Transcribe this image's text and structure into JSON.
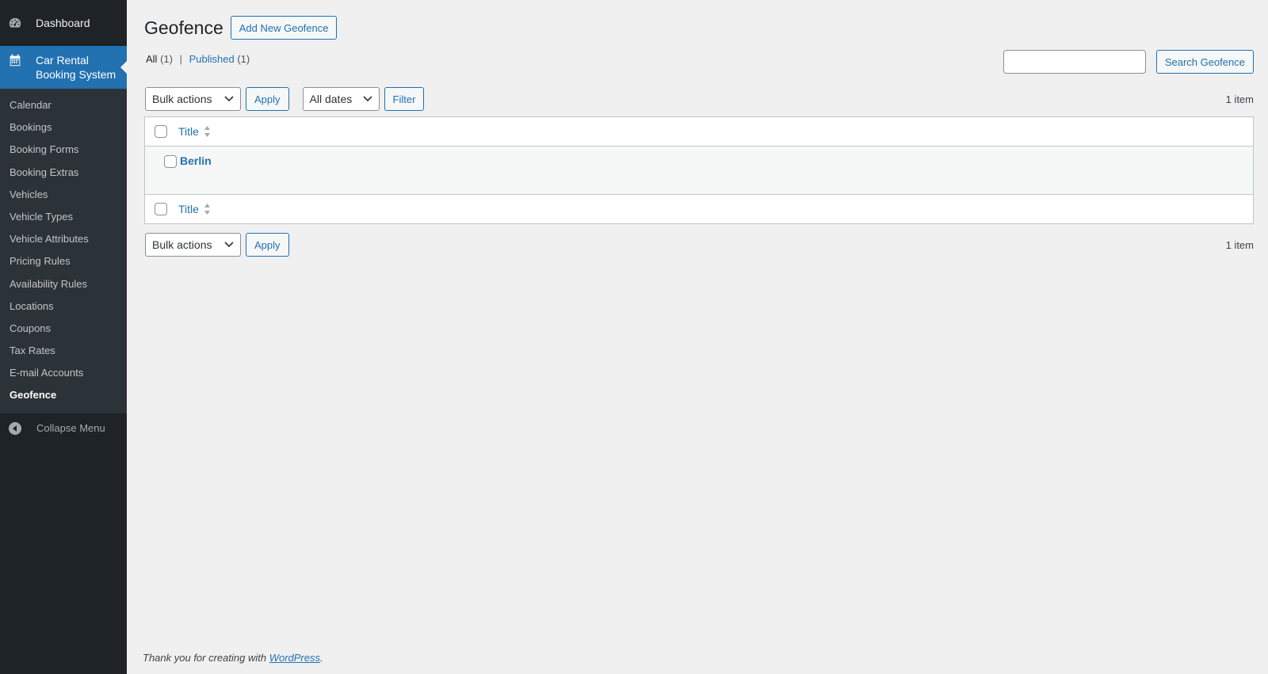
{
  "sidebar": {
    "dashboard_label": "Dashboard",
    "current_menu_label": "Car Rental Booking System",
    "submenu": [
      "Calendar",
      "Bookings",
      "Booking Forms",
      "Booking Extras",
      "Vehicles",
      "Vehicle Types",
      "Vehicle Attributes",
      "Pricing Rules",
      "Availability Rules",
      "Locations",
      "Coupons",
      "Tax Rates",
      "E-mail Accounts",
      "Geofence"
    ],
    "current_submenu": "Geofence",
    "collapse_label": "Collapse Menu"
  },
  "header": {
    "title": "Geofence",
    "add_new_label": "Add New Geofence"
  },
  "views": {
    "all_label": "All",
    "all_count": "(1)",
    "separator": "|",
    "published_label": "Published",
    "published_count": "(1)"
  },
  "search": {
    "value": "",
    "button_label": "Search Geofence"
  },
  "tablenav_top": {
    "bulk_actions": "Bulk actions",
    "apply_label": "Apply",
    "dates_filter": "All dates",
    "filter_label": "Filter",
    "items_count": "1 item"
  },
  "table": {
    "column_title": "Title",
    "rows": [
      {
        "title": "Berlin"
      }
    ]
  },
  "tablenav_bottom": {
    "bulk_actions": "Bulk actions",
    "apply_label": "Apply",
    "items_count": "1 item"
  },
  "footer": {
    "text": "Thank you for creating with",
    "link": "WordPress",
    "suffix": "."
  },
  "colors": {
    "sidebar_bg": "#1d2327",
    "submenu_bg": "#2c3338",
    "accent": "#2271b1",
    "page_bg": "#f0f0f1"
  }
}
